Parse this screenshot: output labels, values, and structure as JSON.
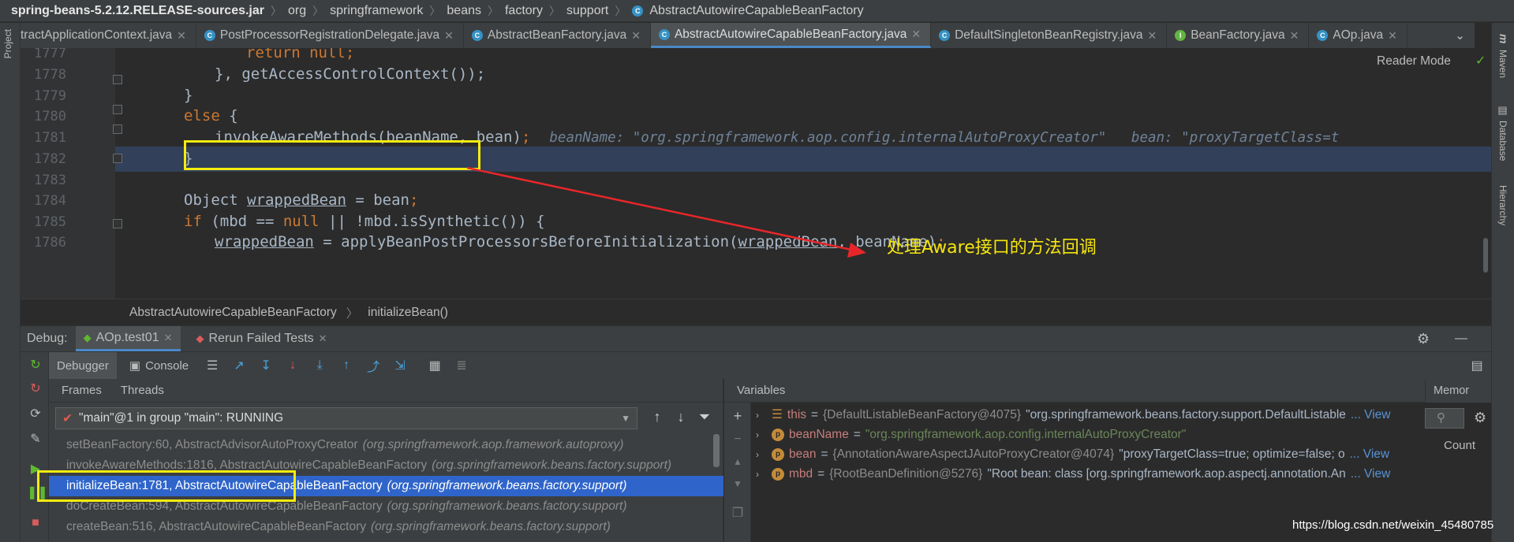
{
  "breadcrumb": {
    "jar": "spring-beans-5.2.12.RELEASE-sources.jar",
    "parts": [
      "org",
      "springframework",
      "beans",
      "factory",
      "support"
    ],
    "current": "AbstractAutowireCapableBeanFactory"
  },
  "tabs": [
    {
      "label": "tractApplicationContext.java",
      "icon": "class-icon"
    },
    {
      "label": "PostProcessorRegistrationDelegate.java",
      "icon": "class-icon"
    },
    {
      "label": "AbstractBeanFactory.java",
      "icon": "abstract-class-icon"
    },
    {
      "label": "AbstractAutowireCapableBeanFactory.java",
      "icon": "abstract-class-icon"
    },
    {
      "label": "DefaultSingletonBeanRegistry.java",
      "icon": "class-icon"
    },
    {
      "label": "BeanFactory.java",
      "icon": "interface-icon"
    },
    {
      "label": "AOp.java",
      "icon": "class-icon"
    }
  ],
  "left_strip": {
    "project": "Project"
  },
  "right_strip": {
    "maven": "Maven",
    "database": "Database",
    "hierarchy": "Hierarchy"
  },
  "editor": {
    "reader_mode": "Reader Mode",
    "line_numbers": [
      "1777",
      "1778",
      "1779",
      "1780",
      "1781",
      "1782",
      "1783",
      "1784",
      "1785",
      "1786"
    ],
    "lines": {
      "l1777_kw": "return null",
      "l1777_end": ";",
      "l1778_a": "},",
      "l1778_b": " getAccessControlContext());",
      "l1779": "}",
      "l1780_kw": "else",
      "l1780_b": " {",
      "l1781_a": "invokeAwareMethods(beanName, bean)",
      "l1781_end": ";",
      "l1782": "}",
      "l1784_a": "Object ",
      "l1784_u": "wrappedBean",
      "l1784_b": " = bean",
      "l1784_end": ";",
      "l1785_kw": "if",
      "l1785_a": " (mbd == ",
      "l1785_kw2": "null",
      "l1785_b": " || !mbd.isSynthetic()) {",
      "l1786_u": "wrappedBean",
      "l1786_a": " = applyBeanPostProcessorsBeforeInitialization(",
      "l1786_u2": "wrappedBean",
      "l1786_b": ", beanName)",
      "l1786_end": ";"
    },
    "inline_hint": "beanName: \"org.springframework.aop.config.internalAutoProxyCreator\"   bean: \"proxyTargetClass=t",
    "annotation": "处理Aware接口的方法回调",
    "crumb_class": "AbstractAutowireCapableBeanFactory",
    "crumb_method": "initializeBean()"
  },
  "debug": {
    "label": "Debug:",
    "session_tab": "AOp.test01",
    "rerun_tab": "Rerun Failed Tests",
    "debugger_tab": "Debugger",
    "console_tab": "Console",
    "frames_tab": "Frames",
    "threads_tab": "Threads",
    "thread_select": "\"main\"@1 in group \"main\": RUNNING",
    "frames": [
      {
        "method": "setBeanFactory:60, AbstractAdvisorAutoProxyCreator",
        "pkg": "(org.springframework.aop.framework.autoproxy)"
      },
      {
        "method": "invokeAwareMethods:1816, AbstractAutowireCapableBeanFactory",
        "pkg": "(org.springframework.beans.factory.support)"
      },
      {
        "method": "initializeBean:1781, AbstractAutowireCapableBeanFactory",
        "pkg": "(org.springframework.beans.factory.support)"
      },
      {
        "method": "doCreateBean:594, AbstractAutowireCapableBeanFactory",
        "pkg": "(org.springframework.beans.factory.support)"
      },
      {
        "method": "createBean:516, AbstractAutowireCapableBeanFactory",
        "pkg": "(org.springframework.beans.factory.support)"
      }
    ],
    "variables_title": "Variables",
    "memory_tab": "Memor",
    "count_label": "Count",
    "variables": [
      {
        "icon": "field-list-icon",
        "name": "this",
        "eq": " = ",
        "type": "{DefaultListableBeanFactory@4075}",
        "value": " \"org.springframework.beans.factory.support.DefaultListable",
        "link": "... View"
      },
      {
        "icon": "parameter-icon",
        "name": "beanName",
        "eq": " = ",
        "type": "",
        "value": "\"org.springframework.aop.config.internalAutoProxyCreator\"",
        "link": ""
      },
      {
        "icon": "parameter-icon",
        "name": "bean",
        "eq": " = ",
        "type": "{AnnotationAwareAspectJAutoProxyCreator@4074}",
        "value": " \"proxyTargetClass=true; optimize=false; o",
        "link": "... View"
      },
      {
        "icon": "parameter-icon",
        "name": "mbd",
        "eq": " = ",
        "type": "{RootBeanDefinition@5276}",
        "value": " \"Root bean: class [org.springframework.aop.aspectj.annotation.An",
        "link": "... View"
      }
    ]
  },
  "watermark": "https://blog.csdn.net/weixin_45480785",
  "colors": {
    "highlight_box": "#f4ec0e",
    "arrow": "#e8262a",
    "selected_frame": "#2f65ca",
    "keyword": "#cc7832"
  }
}
